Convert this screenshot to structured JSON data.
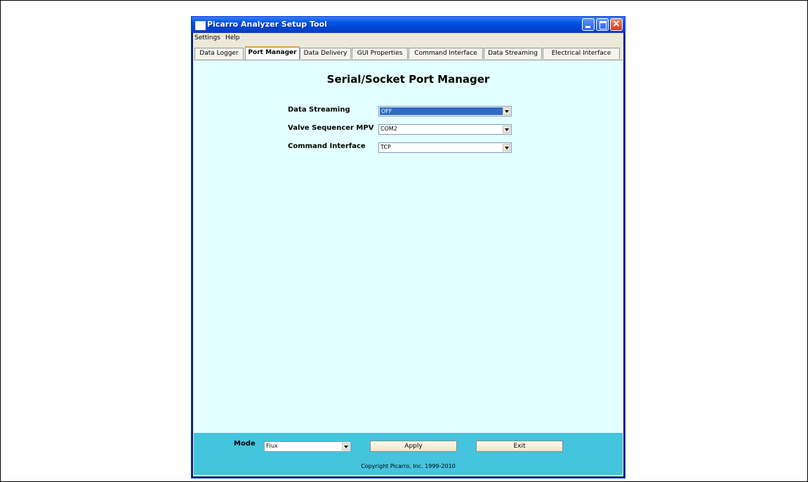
{
  "window": {
    "title": "Picarro Analyzer Setup Tool"
  },
  "menu": [
    "Settings",
    "Help"
  ],
  "tabs": [
    {
      "label": "Data Logger",
      "active": false
    },
    {
      "label": "Port Manager",
      "active": true
    },
    {
      "label": "Data Delivery",
      "active": false
    },
    {
      "label": "GUI Properties",
      "active": false
    },
    {
      "label": "Command Interface",
      "active": false
    },
    {
      "label": "Data Streaming",
      "active": false
    },
    {
      "label": "Electrical Interface",
      "active": false
    }
  ],
  "main": {
    "title": "Serial/Socket Port Manager",
    "fields": [
      {
        "label": "Data Streaming",
        "value": "OFF",
        "focused": true
      },
      {
        "label": "Valve Sequencer MPV",
        "value": "COM2",
        "focused": false
      },
      {
        "label": "Command Interface",
        "value": "TCP",
        "focused": false
      }
    ]
  },
  "footer": {
    "mode_label": "Mode",
    "mode_value": "Flux",
    "apply_label": "Apply",
    "exit_label": "Exit",
    "copyright": "Copyright Picarro, Inc. 1999-2010"
  },
  "colors": {
    "content_bg": "#e3ffff",
    "footer_bg": "#45c4de",
    "titlebar": "#0055e5",
    "selection": "#316ac5"
  },
  "icons": {
    "app": "window-icon",
    "minimize": "minimize-icon",
    "maximize": "maximize-icon",
    "close": "close-icon",
    "dropdown": "chevron-down-icon"
  }
}
